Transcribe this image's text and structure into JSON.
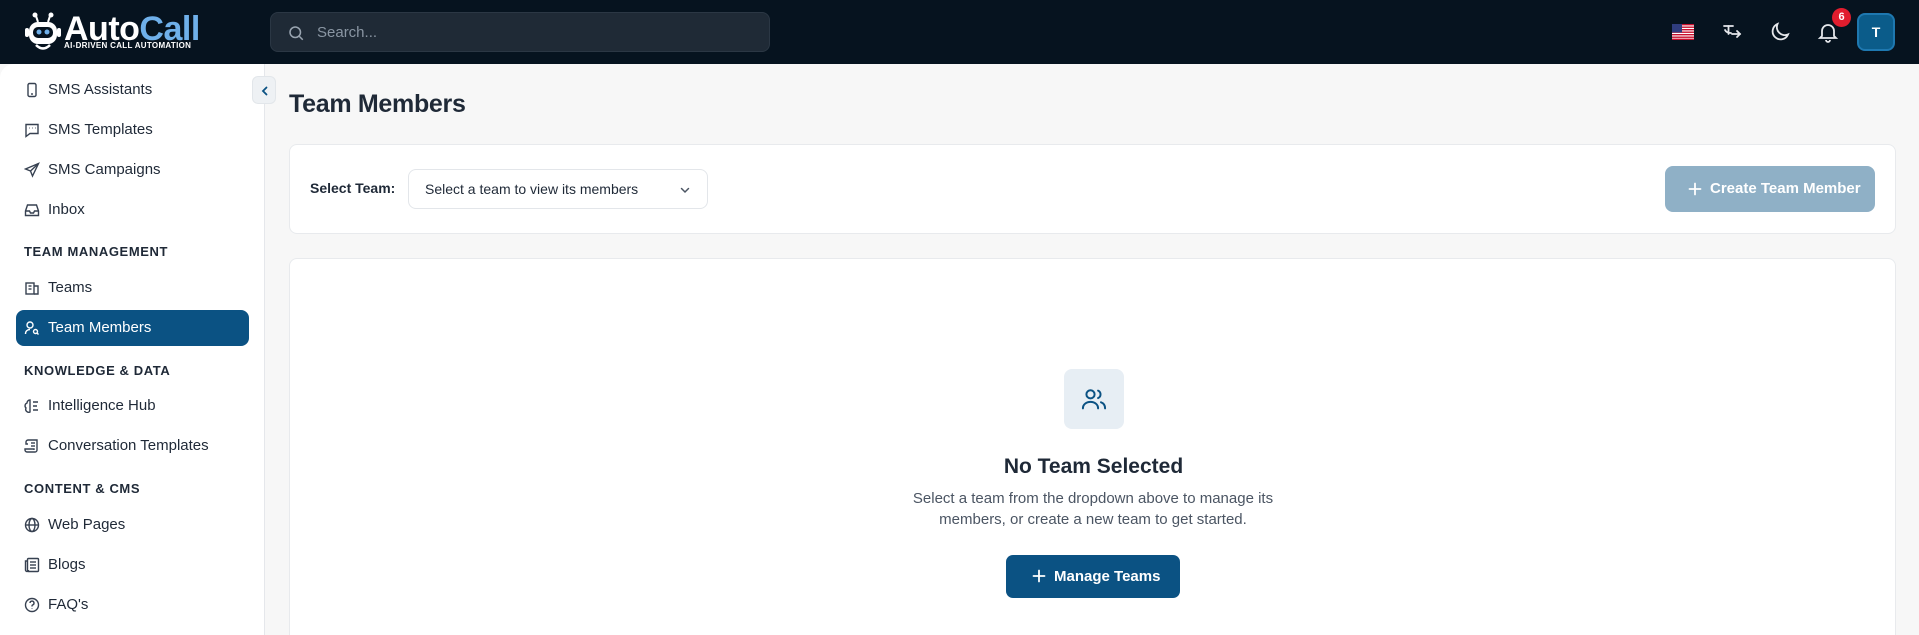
{
  "brand": {
    "name_part1": "Auto",
    "name_part2": "Call",
    "tagline": "AI-DRIVEN CALL AUTOMATION"
  },
  "topbar": {
    "search_placeholder": "Search...",
    "notification_count": "6",
    "avatar_initial": "T",
    "icons": [
      "flag-us-icon",
      "translate-icon",
      "moon-icon",
      "bell-icon"
    ]
  },
  "sidebar": {
    "items_top": [
      {
        "label": "SMS Assistants",
        "icon": "phone-icon"
      },
      {
        "label": "SMS Templates",
        "icon": "message-icon"
      },
      {
        "label": "SMS Campaigns",
        "icon": "send-icon"
      },
      {
        "label": "Inbox",
        "icon": "inbox-icon"
      }
    ],
    "sections": [
      {
        "title": "TEAM MANAGEMENT",
        "items": [
          {
            "label": "Teams",
            "icon": "building-icon"
          },
          {
            "label": "Team Members",
            "icon": "user-icon",
            "active": true
          }
        ]
      },
      {
        "title": "KNOWLEDGE & DATA",
        "items": [
          {
            "label": "Intelligence Hub",
            "icon": "brain-icon"
          },
          {
            "label": "Conversation Templates",
            "icon": "scroll-icon"
          }
        ]
      },
      {
        "title": "CONTENT & CMS",
        "items": [
          {
            "label": "Web Pages",
            "icon": "globe-icon"
          },
          {
            "label": "Blogs",
            "icon": "newspaper-icon"
          },
          {
            "label": "FAQ's",
            "icon": "help-circle-icon"
          }
        ]
      }
    ]
  },
  "main": {
    "title": "Team Members",
    "select_label": "Select Team:",
    "select_value": "Select a team to view its members",
    "create_button": "Create Team Member",
    "empty_title": "No Team Selected",
    "empty_desc": "Select a team from the dropdown above to manage its members, or create a new team to get started.",
    "manage_button": "Manage Teams"
  },
  "colors": {
    "topbar": "#06131f",
    "primary": "#0b5283",
    "primary_disabled": "#8fb0c6",
    "badge": "#e11d2e"
  }
}
